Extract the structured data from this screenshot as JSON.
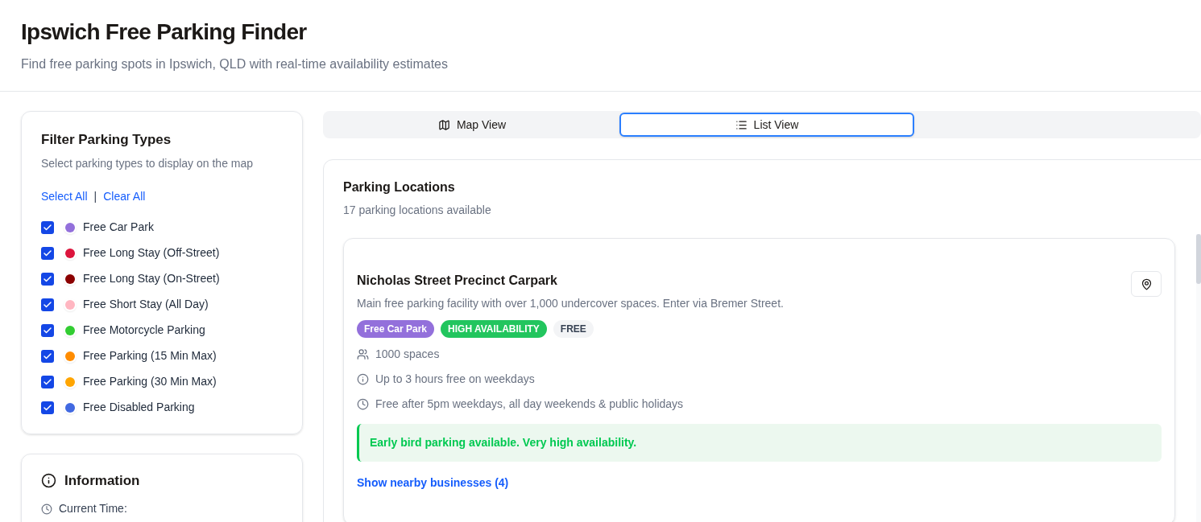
{
  "header": {
    "title": "Ipswich Free Parking Finder",
    "subtitle": "Find free parking spots in Ipswich, QLD with real-time availability estimates"
  },
  "filter": {
    "title": "Filter Parking Types",
    "description": "Select parking types to display on the map",
    "select_all": "Select All",
    "separator": "|",
    "clear_all": "Clear All",
    "types": [
      {
        "label": "Free Car Park",
        "checked": true,
        "color": "#9370db"
      },
      {
        "label": "Free Long Stay (Off-Street)",
        "checked": true,
        "color": "#dc143c"
      },
      {
        "label": "Free Long Stay (On-Street)",
        "checked": true,
        "color": "#8b0000"
      },
      {
        "label": "Free Short Stay (All Day)",
        "checked": true,
        "color": "#ffb6c1"
      },
      {
        "label": "Free Motorcycle Parking",
        "checked": true,
        "color": "#32cd32"
      },
      {
        "label": "Free Parking (15 Min Max)",
        "checked": true,
        "color": "#ff8c00"
      },
      {
        "label": "Free Parking (30 Min Max)",
        "checked": true,
        "color": "#ffa500"
      },
      {
        "label": "Free Disabled Parking",
        "checked": true,
        "color": "#4169e1"
      }
    ]
  },
  "information": {
    "title": "Information",
    "current_time_label": "Current Time:"
  },
  "tabs": [
    {
      "label": "Map View",
      "kind": "map",
      "selected": false
    },
    {
      "label": "List View",
      "kind": "list",
      "selected": true
    }
  ],
  "locations": {
    "title": "Parking Locations",
    "count": "17 parking locations available",
    "items": [
      {
        "name": "Nicholas Street Precinct Carpark",
        "description": "Main free parking facility with over 1,000 undercover spaces. Enter via Bremer Street.",
        "tags": [
          {
            "label": "Free Car Park",
            "color": "#9370db"
          },
          {
            "label": "HIGH AVAILABILITY",
            "color": "#22c55e"
          },
          {
            "label": "FREE",
            "color": "#f3f4f6"
          }
        ],
        "details": [
          {
            "kind": "spaces",
            "text": "1000 spaces"
          },
          {
            "kind": "info",
            "text": "Up to 3 hours free on weekdays"
          },
          {
            "kind": "time",
            "text": "Free after 5pm weekdays, all day weekends & public holidays"
          }
        ],
        "note": "Early bird parking available. Very high availability.",
        "link": "Show nearby businesses (4)"
      }
    ]
  }
}
